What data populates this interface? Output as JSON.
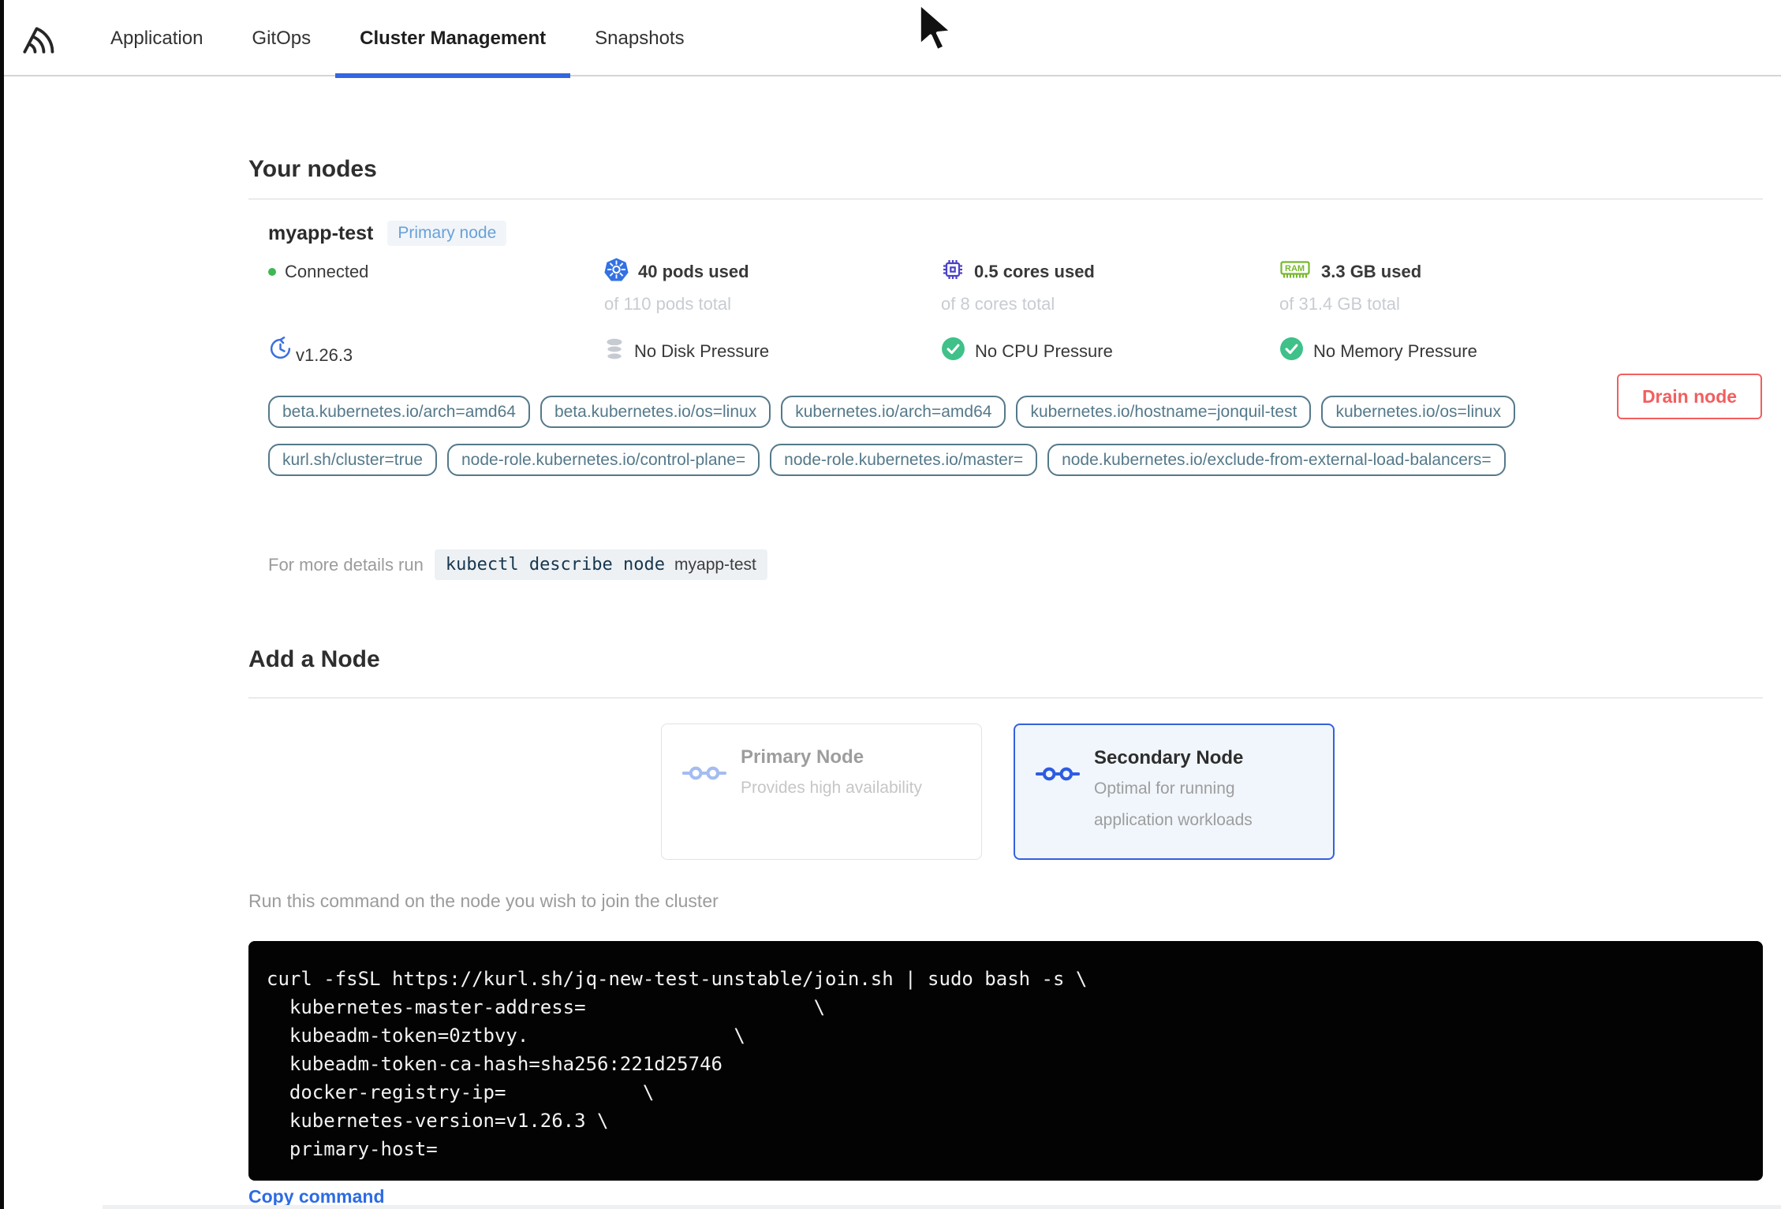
{
  "nav": {
    "tabs": [
      {
        "label": "Application"
      },
      {
        "label": "GitOps"
      },
      {
        "label": "Cluster Management"
      },
      {
        "label": "Snapshots"
      }
    ],
    "active_tab": "Cluster Management"
  },
  "your_nodes": {
    "title": "Your nodes",
    "node": {
      "name": "myapp-test",
      "badge": "Primary node",
      "status": "Connected",
      "version": "v1.26.3",
      "stats": [
        {
          "icon": "kubernetes-icon",
          "used": "40 pods used",
          "total": "of 110 pods total"
        },
        {
          "icon": "cpu-icon",
          "used": "0.5 cores used",
          "total": "of 8 cores total"
        },
        {
          "icon": "ram-icon",
          "used": "3.3 GB used",
          "total": "of 31.4 GB total"
        }
      ],
      "conditions": [
        {
          "icon": "disk-icon",
          "label": "No Disk Pressure"
        },
        {
          "icon": "check-icon",
          "label": "No CPU Pressure"
        },
        {
          "icon": "check-icon",
          "label": "No Memory Pressure"
        }
      ],
      "labels": [
        "beta.kubernetes.io/arch=amd64",
        "beta.kubernetes.io/os=linux",
        "kubernetes.io/arch=amd64",
        "kubernetes.io/hostname=jonquil-test",
        "kubernetes.io/os=linux",
        "kurl.sh/cluster=true",
        "node-role.kubernetes.io/control-plane=",
        "node-role.kubernetes.io/master=",
        "node.kubernetes.io/exclude-from-external-load-balancers="
      ],
      "details_prefix": "For more details run",
      "details_command": "kubectl describe node",
      "details_node": "myapp-test",
      "drain_button": "Drain node"
    }
  },
  "add_node": {
    "title": "Add a Node",
    "options": [
      {
        "title": "Primary Node",
        "description": "Provides high availability",
        "selected": false
      },
      {
        "title": "Secondary Node",
        "description": "Optimal for running application workloads",
        "selected": true
      }
    ],
    "instruction": "Run this command on the node you wish to join the cluster",
    "command_lines": [
      "curl -fsSL https://kurl.sh/jq-new-test-unstable/join.sh | sudo bash -s \\",
      "  kubernetes-master-address=                    \\",
      "  kubeadm-token=0ztbvy.                  \\",
      "  kubeadm-token-ca-hash=sha256:221d25746",
      "  docker-registry-ip=            \\",
      "  kubernetes-version=v1.26.3 \\",
      "  primary-host="
    ],
    "copy_label": "Copy command"
  },
  "colors": {
    "accent_blue": "#3366e0",
    "kubernetes_blue": "#3371e3",
    "cpu_indigo": "#4b42c4",
    "ram_green": "#76b82c",
    "check_green": "#3fc189",
    "connected_green": "#3eb853",
    "tag_teal": "#54798a",
    "danger_red": "#f25e5e",
    "link_blue": "#2c6be4"
  }
}
